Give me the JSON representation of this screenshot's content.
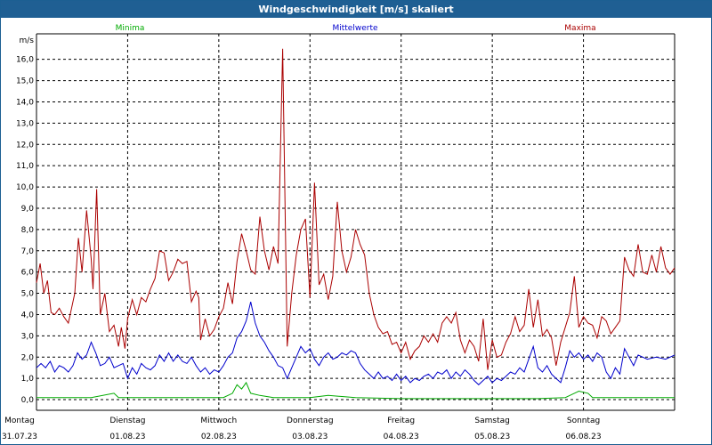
{
  "window": {
    "title": "Windgeschwindigkeit [m/s] skaliert"
  },
  "colors": {
    "min": "#00aa00",
    "avg": "#0000cc",
    "max": "#aa0000",
    "title_bar": "#1f5f93",
    "grid": "#000000"
  },
  "chart_data": {
    "type": "line",
    "ylabel": "m/s",
    "ylim": [
      -0.5,
      17.2
    ],
    "yticks": [
      "0,0",
      "1,0",
      "2,0",
      "3,0",
      "4,0",
      "5,0",
      "6,0",
      "7,0",
      "8,0",
      "9,0",
      "10,0",
      "11,0",
      "12,0",
      "13,0",
      "14,0",
      "15,0",
      "16,0"
    ],
    "grid": true,
    "legend_position": "top",
    "x_unit": "days from 31.07.23 00:00",
    "xlim": [
      0,
      7
    ],
    "day_labels": [
      {
        "day": "Montag",
        "date": "31.07.23"
      },
      {
        "day": "Dienstag",
        "date": "01.08.23"
      },
      {
        "day": "Mittwoch",
        "date": "02.08.23"
      },
      {
        "day": "Donnerstag",
        "date": "03.08.23"
      },
      {
        "day": "Freitag",
        "date": "04.08.23"
      },
      {
        "day": "Samstag",
        "date": "05.08.23"
      },
      {
        "day": "Sonntag",
        "date": "06.08.23"
      }
    ],
    "series": [
      {
        "name": "Minima",
        "color": "#00aa00",
        "points": [
          [
            0,
            0.1
          ],
          [
            0.3,
            0.1
          ],
          [
            0.6,
            0.1
          ],
          [
            0.85,
            0.3
          ],
          [
            0.9,
            0.1
          ],
          [
            1.2,
            0.1
          ],
          [
            1.7,
            0.1
          ],
          [
            2.05,
            0.1
          ],
          [
            2.15,
            0.3
          ],
          [
            2.2,
            0.7
          ],
          [
            2.25,
            0.5
          ],
          [
            2.3,
            0.8
          ],
          [
            2.35,
            0.3
          ],
          [
            2.45,
            0.2
          ],
          [
            2.6,
            0.1
          ],
          [
            2.8,
            0.1
          ],
          [
            3.0,
            0.1
          ],
          [
            3.2,
            0.2
          ],
          [
            3.5,
            0.1
          ],
          [
            4.0,
            0.05
          ],
          [
            4.5,
            0.05
          ],
          [
            5.0,
            0.05
          ],
          [
            5.5,
            0.05
          ],
          [
            5.8,
            0.1
          ],
          [
            5.9,
            0.3
          ],
          [
            5.95,
            0.4
          ],
          [
            6.05,
            0.3
          ],
          [
            6.1,
            0.1
          ],
          [
            6.5,
            0.1
          ],
          [
            7.0,
            0.1
          ]
        ]
      },
      {
        "name": "Mittelwerte",
        "color": "#0000cc",
        "points": [
          [
            0,
            1.5
          ],
          [
            0.05,
            1.7
          ],
          [
            0.1,
            1.5
          ],
          [
            0.15,
            1.8
          ],
          [
            0.2,
            1.3
          ],
          [
            0.25,
            1.6
          ],
          [
            0.3,
            1.5
          ],
          [
            0.35,
            1.3
          ],
          [
            0.4,
            1.6
          ],
          [
            0.45,
            2.2
          ],
          [
            0.5,
            1.9
          ],
          [
            0.55,
            2.1
          ],
          [
            0.6,
            2.7
          ],
          [
            0.65,
            2.2
          ],
          [
            0.7,
            1.6
          ],
          [
            0.75,
            1.7
          ],
          [
            0.8,
            2.0
          ],
          [
            0.85,
            1.5
          ],
          [
            0.9,
            1.6
          ],
          [
            0.95,
            1.7
          ],
          [
            1.0,
            1.0
          ],
          [
            1.05,
            1.5
          ],
          [
            1.1,
            1.2
          ],
          [
            1.15,
            1.7
          ],
          [
            1.2,
            1.5
          ],
          [
            1.25,
            1.4
          ],
          [
            1.3,
            1.6
          ],
          [
            1.35,
            2.1
          ],
          [
            1.4,
            1.8
          ],
          [
            1.45,
            2.2
          ],
          [
            1.5,
            1.8
          ],
          [
            1.55,
            2.1
          ],
          [
            1.6,
            1.8
          ],
          [
            1.65,
            1.7
          ],
          [
            1.7,
            2.0
          ],
          [
            1.75,
            1.6
          ],
          [
            1.8,
            1.3
          ],
          [
            1.85,
            1.5
          ],
          [
            1.9,
            1.2
          ],
          [
            1.95,
            1.4
          ],
          [
            2.0,
            1.3
          ],
          [
            2.05,
            1.6
          ],
          [
            2.1,
            2.0
          ],
          [
            2.15,
            2.2
          ],
          [
            2.2,
            2.9
          ],
          [
            2.25,
            3.2
          ],
          [
            2.3,
            3.7
          ],
          [
            2.35,
            4.6
          ],
          [
            2.4,
            3.6
          ],
          [
            2.45,
            3.0
          ],
          [
            2.5,
            2.7
          ],
          [
            2.55,
            2.3
          ],
          [
            2.6,
            2.0
          ],
          [
            2.65,
            1.6
          ],
          [
            2.7,
            1.5
          ],
          [
            2.75,
            1.0
          ],
          [
            2.8,
            1.5
          ],
          [
            2.85,
            2.0
          ],
          [
            2.9,
            2.5
          ],
          [
            2.95,
            2.2
          ],
          [
            3.0,
            2.4
          ],
          [
            3.05,
            1.9
          ],
          [
            3.1,
            1.6
          ],
          [
            3.15,
            2.0
          ],
          [
            3.2,
            2.2
          ],
          [
            3.25,
            1.9
          ],
          [
            3.3,
            2.0
          ],
          [
            3.35,
            2.2
          ],
          [
            3.4,
            2.1
          ],
          [
            3.45,
            2.3
          ],
          [
            3.5,
            2.2
          ],
          [
            3.55,
            1.7
          ],
          [
            3.6,
            1.4
          ],
          [
            3.65,
            1.2
          ],
          [
            3.7,
            1.0
          ],
          [
            3.75,
            1.3
          ],
          [
            3.8,
            1.0
          ],
          [
            3.85,
            1.1
          ],
          [
            3.9,
            0.9
          ],
          [
            3.95,
            1.2
          ],
          [
            4.0,
            0.9
          ],
          [
            4.05,
            1.1
          ],
          [
            4.1,
            0.8
          ],
          [
            4.15,
            1.0
          ],
          [
            4.2,
            0.9
          ],
          [
            4.25,
            1.1
          ],
          [
            4.3,
            1.2
          ],
          [
            4.35,
            1.0
          ],
          [
            4.4,
            1.3
          ],
          [
            4.45,
            1.2
          ],
          [
            4.5,
            1.4
          ],
          [
            4.55,
            1.0
          ],
          [
            4.6,
            1.3
          ],
          [
            4.65,
            1.1
          ],
          [
            4.7,
            1.4
          ],
          [
            4.75,
            1.2
          ],
          [
            4.8,
            0.9
          ],
          [
            4.85,
            0.7
          ],
          [
            4.9,
            0.9
          ],
          [
            4.95,
            1.1
          ],
          [
            5.0,
            0.8
          ],
          [
            5.05,
            1.0
          ],
          [
            5.1,
            0.9
          ],
          [
            5.15,
            1.1
          ],
          [
            5.2,
            1.3
          ],
          [
            5.25,
            1.2
          ],
          [
            5.3,
            1.5
          ],
          [
            5.35,
            1.3
          ],
          [
            5.4,
            1.9
          ],
          [
            5.45,
            2.5
          ],
          [
            5.5,
            1.5
          ],
          [
            5.55,
            1.3
          ],
          [
            5.6,
            1.6
          ],
          [
            5.65,
            1.2
          ],
          [
            5.7,
            1.0
          ],
          [
            5.75,
            0.8
          ],
          [
            5.8,
            1.5
          ],
          [
            5.85,
            2.3
          ],
          [
            5.9,
            2.0
          ],
          [
            5.95,
            2.2
          ],
          [
            6.0,
            1.9
          ],
          [
            6.05,
            2.1
          ],
          [
            6.1,
            1.8
          ],
          [
            6.15,
            2.2
          ],
          [
            6.2,
            2.0
          ],
          [
            6.25,
            1.3
          ],
          [
            6.3,
            1.0
          ],
          [
            6.35,
            1.5
          ],
          [
            6.4,
            1.2
          ],
          [
            6.45,
            2.4
          ],
          [
            6.5,
            2.0
          ],
          [
            6.55,
            1.6
          ],
          [
            6.6,
            2.1
          ],
          [
            6.7,
            1.9
          ],
          [
            6.8,
            2.0
          ],
          [
            6.9,
            1.9
          ],
          [
            7.0,
            2.1
          ]
        ]
      },
      {
        "name": "Maxima",
        "color": "#aa0000",
        "points": [
          [
            0,
            5.5
          ],
          [
            0.04,
            6.4
          ],
          [
            0.08,
            5.0
          ],
          [
            0.12,
            5.6
          ],
          [
            0.16,
            4.1
          ],
          [
            0.2,
            4.0
          ],
          [
            0.25,
            4.3
          ],
          [
            0.3,
            3.9
          ],
          [
            0.35,
            3.6
          ],
          [
            0.38,
            4.2
          ],
          [
            0.42,
            5.0
          ],
          [
            0.46,
            7.6
          ],
          [
            0.5,
            6.0
          ],
          [
            0.55,
            8.9
          ],
          [
            0.6,
            6.6
          ],
          [
            0.62,
            5.2
          ],
          [
            0.66,
            9.9
          ],
          [
            0.7,
            4.0
          ],
          [
            0.75,
            5.0
          ],
          [
            0.8,
            3.2
          ],
          [
            0.85,
            3.5
          ],
          [
            0.9,
            2.5
          ],
          [
            0.93,
            3.4
          ],
          [
            0.97,
            2.4
          ],
          [
            1.0,
            3.8
          ],
          [
            1.05,
            4.7
          ],
          [
            1.1,
            4.0
          ],
          [
            1.15,
            4.8
          ],
          [
            1.2,
            4.6
          ],
          [
            1.25,
            5.2
          ],
          [
            1.3,
            5.7
          ],
          [
            1.35,
            7.0
          ],
          [
            1.4,
            6.9
          ],
          [
            1.45,
            5.6
          ],
          [
            1.5,
            6.0
          ],
          [
            1.55,
            6.6
          ],
          [
            1.6,
            6.4
          ],
          [
            1.65,
            6.5
          ],
          [
            1.7,
            4.6
          ],
          [
            1.75,
            5.1
          ],
          [
            1.78,
            4.8
          ],
          [
            1.8,
            2.8
          ],
          [
            1.85,
            3.8
          ],
          [
            1.9,
            3.0
          ],
          [
            1.95,
            3.3
          ],
          [
            2.0,
            3.9
          ],
          [
            2.05,
            4.3
          ],
          [
            2.1,
            5.5
          ],
          [
            2.15,
            4.5
          ],
          [
            2.2,
            6.5
          ],
          [
            2.25,
            7.8
          ],
          [
            2.3,
            7.0
          ],
          [
            2.35,
            6.1
          ],
          [
            2.4,
            5.9
          ],
          [
            2.45,
            8.6
          ],
          [
            2.5,
            7.0
          ],
          [
            2.55,
            6.1
          ],
          [
            2.6,
            7.2
          ],
          [
            2.65,
            6.4
          ],
          [
            2.7,
            16.5
          ],
          [
            2.75,
            2.5
          ],
          [
            2.8,
            5.0
          ],
          [
            2.85,
            6.8
          ],
          [
            2.9,
            8.0
          ],
          [
            2.95,
            8.5
          ],
          [
            3.0,
            4.8
          ],
          [
            3.05,
            10.2
          ],
          [
            3.1,
            5.4
          ],
          [
            3.15,
            5.9
          ],
          [
            3.2,
            4.7
          ],
          [
            3.25,
            5.8
          ],
          [
            3.3,
            9.3
          ],
          [
            3.35,
            7.0
          ],
          [
            3.4,
            6.0
          ],
          [
            3.45,
            6.7
          ],
          [
            3.5,
            8.0
          ],
          [
            3.55,
            7.3
          ],
          [
            3.6,
            6.8
          ],
          [
            3.65,
            5.0
          ],
          [
            3.7,
            4.0
          ],
          [
            3.75,
            3.4
          ],
          [
            3.8,
            3.1
          ],
          [
            3.85,
            3.2
          ],
          [
            3.9,
            2.6
          ],
          [
            3.95,
            2.7
          ],
          [
            4.0,
            2.2
          ],
          [
            4.05,
            2.7
          ],
          [
            4.1,
            1.9
          ],
          [
            4.15,
            2.3
          ],
          [
            4.2,
            2.5
          ],
          [
            4.25,
            3.0
          ],
          [
            4.3,
            2.7
          ],
          [
            4.35,
            3.1
          ],
          [
            4.4,
            2.7
          ],
          [
            4.45,
            3.6
          ],
          [
            4.5,
            3.9
          ],
          [
            4.55,
            3.6
          ],
          [
            4.6,
            4.1
          ],
          [
            4.65,
            2.8
          ],
          [
            4.7,
            2.2
          ],
          [
            4.75,
            2.8
          ],
          [
            4.8,
            2.5
          ],
          [
            4.85,
            1.8
          ],
          [
            4.9,
            3.8
          ],
          [
            4.95,
            1.4
          ],
          [
            5.0,
            2.8
          ],
          [
            5.05,
            2.0
          ],
          [
            5.1,
            2.1
          ],
          [
            5.15,
            2.7
          ],
          [
            5.2,
            3.1
          ],
          [
            5.25,
            3.9
          ],
          [
            5.3,
            3.2
          ],
          [
            5.35,
            3.5
          ],
          [
            5.4,
            5.2
          ],
          [
            5.45,
            3.4
          ],
          [
            5.5,
            4.7
          ],
          [
            5.55,
            3.0
          ],
          [
            5.6,
            3.3
          ],
          [
            5.65,
            2.9
          ],
          [
            5.7,
            1.6
          ],
          [
            5.75,
            2.7
          ],
          [
            5.8,
            3.4
          ],
          [
            5.85,
            4.1
          ],
          [
            5.9,
            5.8
          ],
          [
            5.95,
            3.4
          ],
          [
            6.0,
            3.9
          ],
          [
            6.05,
            3.6
          ],
          [
            6.1,
            3.5
          ],
          [
            6.15,
            2.9
          ],
          [
            6.2,
            3.9
          ],
          [
            6.25,
            3.7
          ],
          [
            6.3,
            3.1
          ],
          [
            6.35,
            3.4
          ],
          [
            6.4,
            3.7
          ],
          [
            6.45,
            6.7
          ],
          [
            6.5,
            6.1
          ],
          [
            6.55,
            5.8
          ],
          [
            6.6,
            7.3
          ],
          [
            6.65,
            6.0
          ],
          [
            6.7,
            5.9
          ],
          [
            6.75,
            6.8
          ],
          [
            6.8,
            6.0
          ],
          [
            6.85,
            7.2
          ],
          [
            6.9,
            6.2
          ],
          [
            6.95,
            5.9
          ],
          [
            7.0,
            6.2
          ]
        ]
      }
    ]
  }
}
